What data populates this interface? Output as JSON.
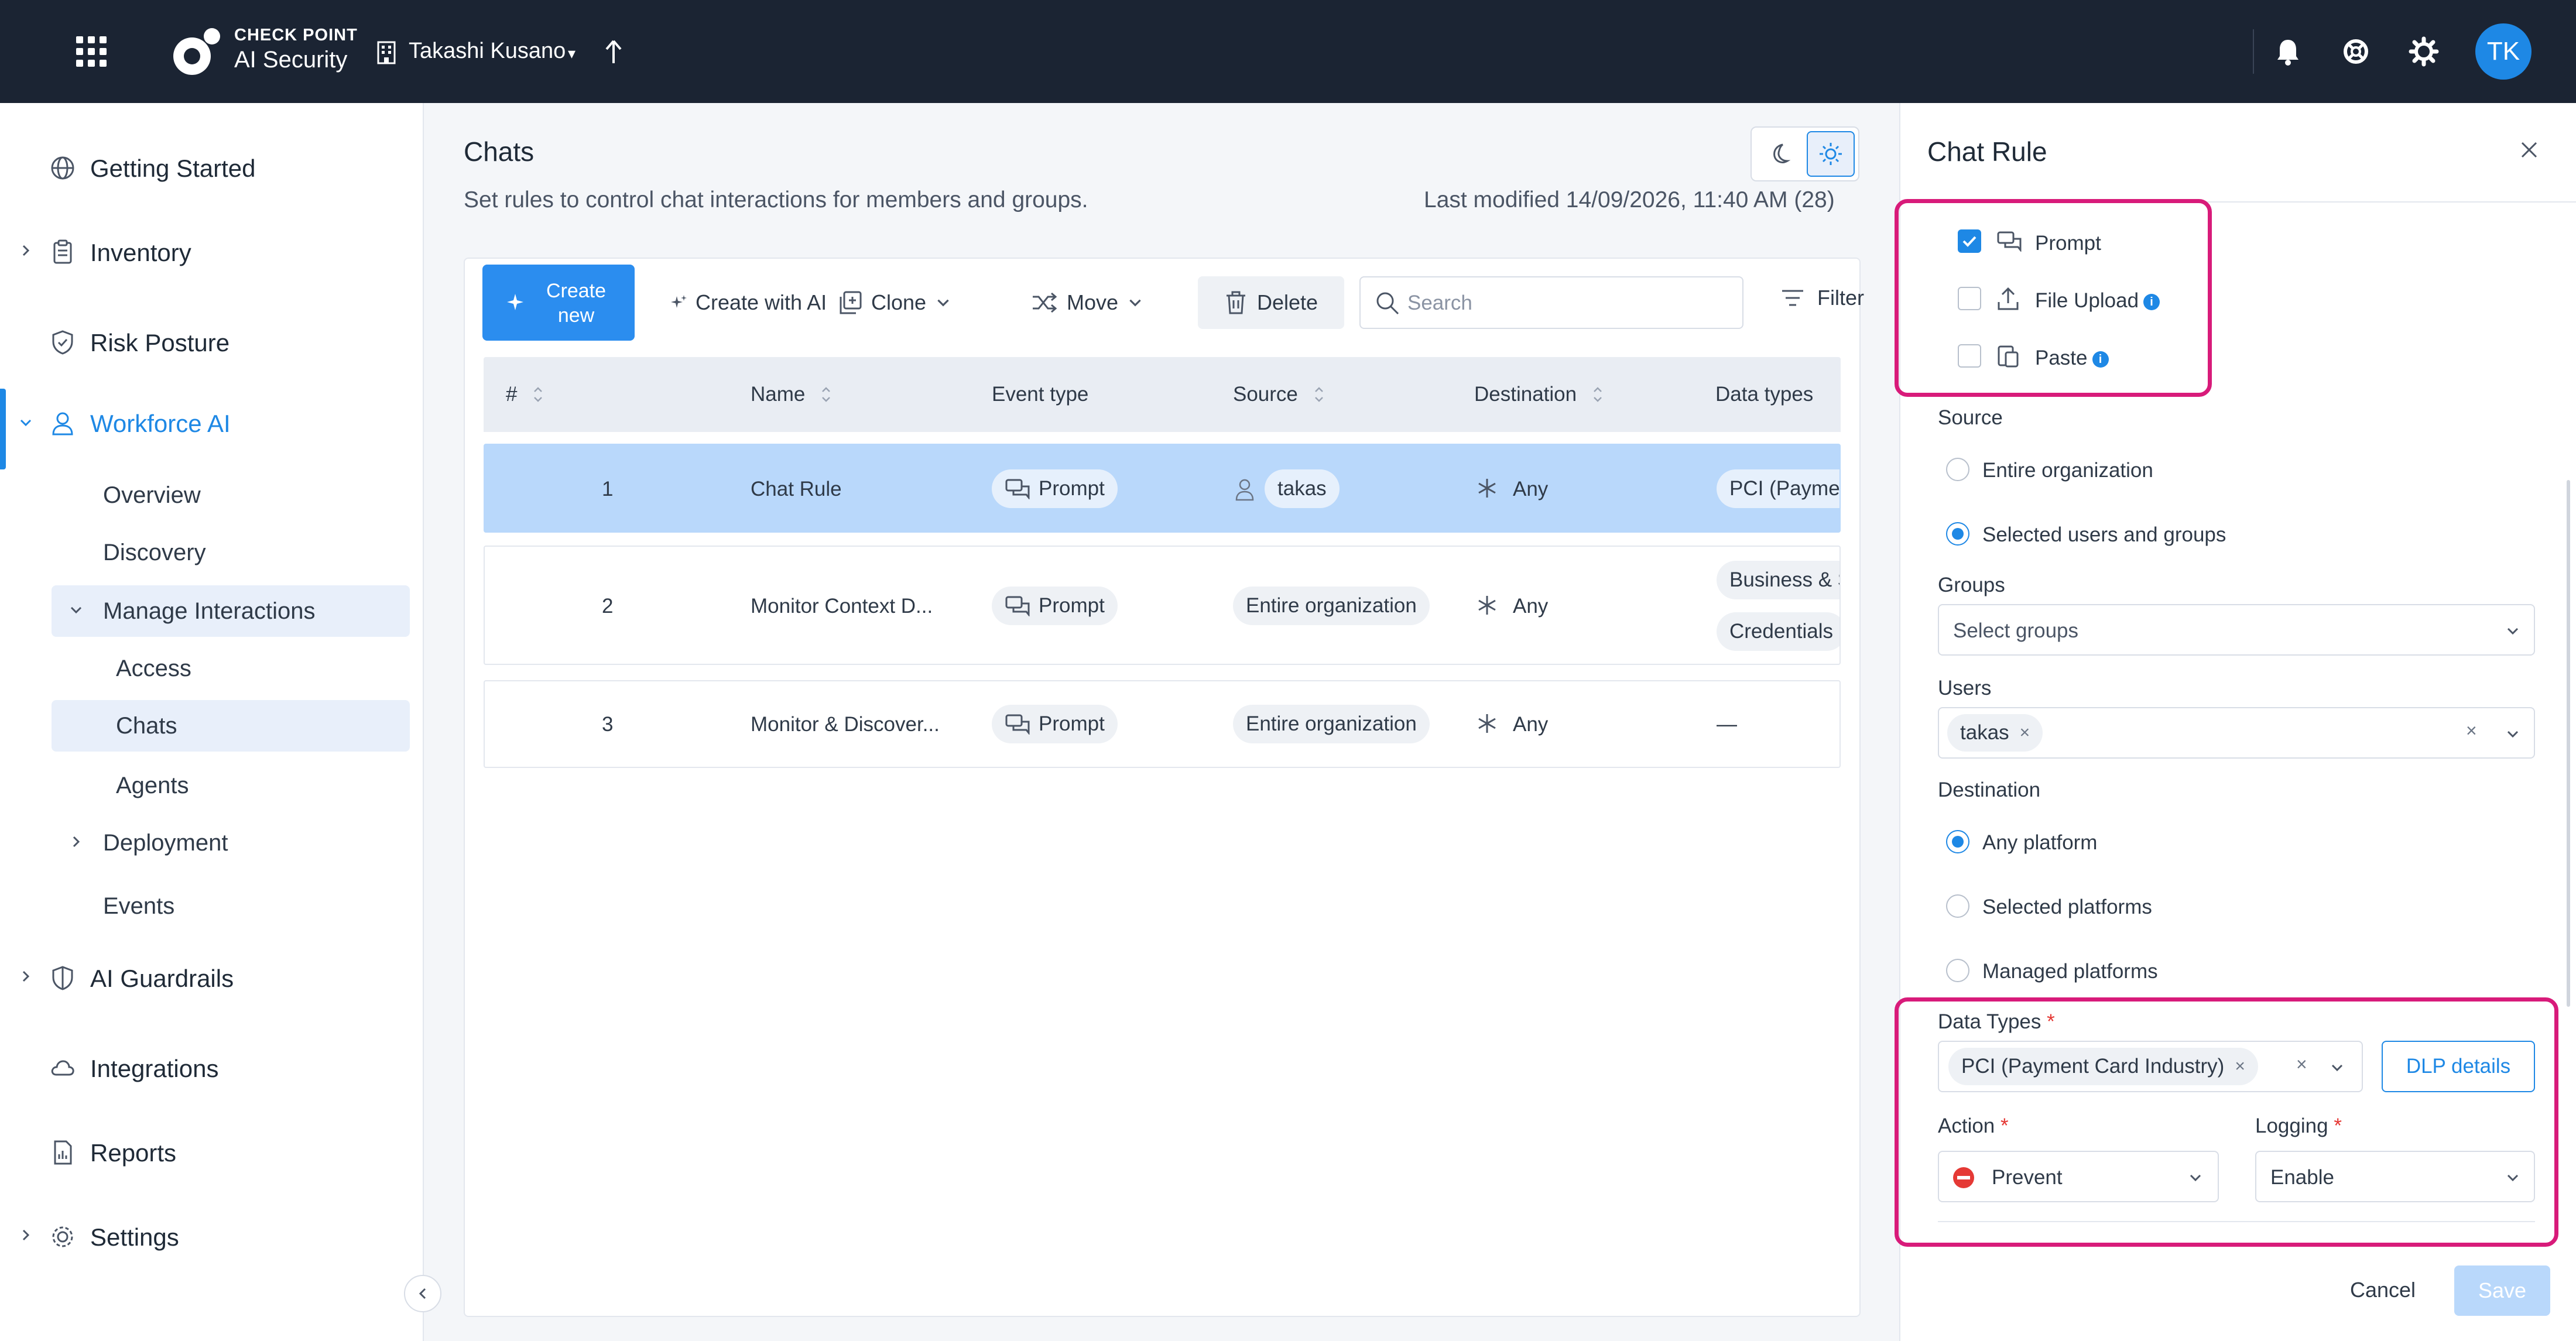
{
  "topbar": {
    "brand": "CHECK POINT",
    "product": "AI Security",
    "tenant": "Takashi Kusano",
    "avatar_initials": "TK"
  },
  "sidebar": {
    "items": [
      {
        "label": "Getting Started"
      },
      {
        "label": "Inventory"
      },
      {
        "label": "Risk Posture"
      },
      {
        "label": "Workforce AI"
      },
      {
        "label": "AI Guardrails"
      },
      {
        "label": "Integrations"
      },
      {
        "label": "Reports"
      },
      {
        "label": "Settings"
      }
    ],
    "workforce_sub": {
      "overview": "Overview",
      "discovery": "Discovery",
      "manage": "Manage Interactions",
      "access": "Access",
      "chats": "Chats",
      "agents": "Agents",
      "deployment": "Deployment",
      "events": "Events"
    }
  },
  "main": {
    "title": "Chats",
    "subtitle": "Set rules to control chat interactions for members and groups.",
    "last_modified": "Last modified 14/09/2026, 11:40 AM (28)",
    "toolbar": {
      "create_new": "Create new",
      "create_ai": "Create with AI",
      "clone": "Clone",
      "move": "Move",
      "delete": "Delete",
      "search_placeholder": "Search",
      "filter": "Filter"
    },
    "columns": [
      "#",
      "Name",
      "Event type",
      "Source",
      "Destination",
      "Data types"
    ],
    "rows": [
      {
        "num": "1",
        "name": "Chat Rule",
        "event": "Prompt",
        "source": "takas",
        "destination": "Any",
        "data1": "PCI (Payment Card Industry)",
        "data2": ""
      },
      {
        "num": "2",
        "name": "Monitor Context D...",
        "event": "Prompt",
        "source": "Entire organization",
        "destination": "Any",
        "data1": "Business & Strategy",
        "data2": "Credentials"
      },
      {
        "num": "3",
        "name": "Monitor & Discover...",
        "event": "Prompt",
        "source": "Entire organization",
        "destination": "Any",
        "data1": "—",
        "data2": ""
      }
    ]
  },
  "panel": {
    "title": "Chat Rule",
    "events": {
      "prompt": "Prompt",
      "file_upload": "File Upload",
      "paste": "Paste"
    },
    "source_label": "Source",
    "source_entire": "Entire organization",
    "source_selected": "Selected users and groups",
    "groups_label": "Groups",
    "groups_placeholder": "Select groups",
    "users_label": "Users",
    "users_tag": "takas",
    "destination_label": "Destination",
    "dest_any": "Any platform",
    "dest_selected": "Selected platforms",
    "dest_managed": "Managed platforms",
    "data_types_label": "Data Types",
    "data_types_tag": "PCI (Payment Card Industry)",
    "dlp_details": "DLP details",
    "action_label": "Action",
    "action_value": "Prevent",
    "logging_label": "Logging",
    "logging_value": "Enable",
    "cancel": "Cancel",
    "save": "Save",
    "required_mark": "*"
  },
  "colors": {
    "accent": "#1e88e5",
    "highlight": "#d81b7a",
    "topbar": "#1b2433",
    "prevent": "#e53935"
  }
}
